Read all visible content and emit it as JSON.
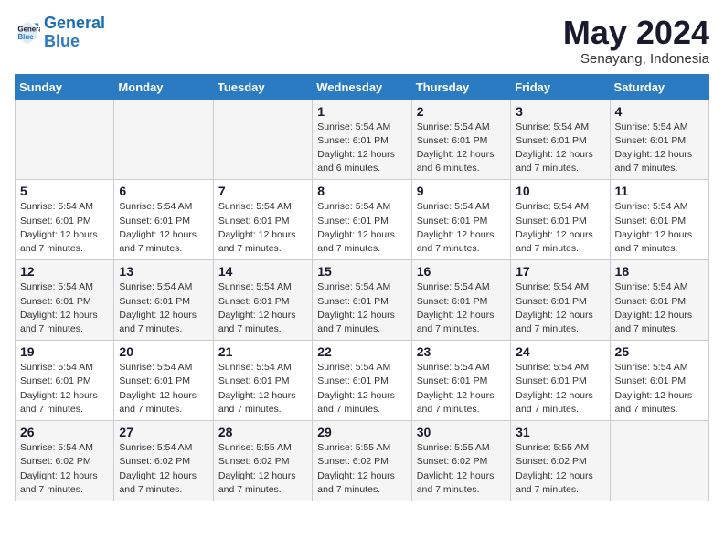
{
  "logo": {
    "line1": "General",
    "line2": "Blue"
  },
  "title": "May 2024",
  "subtitle": "Senayang, Indonesia",
  "days_of_week": [
    "Sunday",
    "Monday",
    "Tuesday",
    "Wednesday",
    "Thursday",
    "Friday",
    "Saturday"
  ],
  "weeks": [
    [
      {
        "day": "",
        "info": ""
      },
      {
        "day": "",
        "info": ""
      },
      {
        "day": "",
        "info": ""
      },
      {
        "day": "1",
        "info": "Sunrise: 5:54 AM\nSunset: 6:01 PM\nDaylight: 12 hours\nand 6 minutes."
      },
      {
        "day": "2",
        "info": "Sunrise: 5:54 AM\nSunset: 6:01 PM\nDaylight: 12 hours\nand 6 minutes."
      },
      {
        "day": "3",
        "info": "Sunrise: 5:54 AM\nSunset: 6:01 PM\nDaylight: 12 hours\nand 7 minutes."
      },
      {
        "day": "4",
        "info": "Sunrise: 5:54 AM\nSunset: 6:01 PM\nDaylight: 12 hours\nand 7 minutes."
      }
    ],
    [
      {
        "day": "5",
        "info": "Sunrise: 5:54 AM\nSunset: 6:01 PM\nDaylight: 12 hours\nand 7 minutes."
      },
      {
        "day": "6",
        "info": "Sunrise: 5:54 AM\nSunset: 6:01 PM\nDaylight: 12 hours\nand 7 minutes."
      },
      {
        "day": "7",
        "info": "Sunrise: 5:54 AM\nSunset: 6:01 PM\nDaylight: 12 hours\nand 7 minutes."
      },
      {
        "day": "8",
        "info": "Sunrise: 5:54 AM\nSunset: 6:01 PM\nDaylight: 12 hours\nand 7 minutes."
      },
      {
        "day": "9",
        "info": "Sunrise: 5:54 AM\nSunset: 6:01 PM\nDaylight: 12 hours\nand 7 minutes."
      },
      {
        "day": "10",
        "info": "Sunrise: 5:54 AM\nSunset: 6:01 PM\nDaylight: 12 hours\nand 7 minutes."
      },
      {
        "day": "11",
        "info": "Sunrise: 5:54 AM\nSunset: 6:01 PM\nDaylight: 12 hours\nand 7 minutes."
      }
    ],
    [
      {
        "day": "12",
        "info": "Sunrise: 5:54 AM\nSunset: 6:01 PM\nDaylight: 12 hours\nand 7 minutes."
      },
      {
        "day": "13",
        "info": "Sunrise: 5:54 AM\nSunset: 6:01 PM\nDaylight: 12 hours\nand 7 minutes."
      },
      {
        "day": "14",
        "info": "Sunrise: 5:54 AM\nSunset: 6:01 PM\nDaylight: 12 hours\nand 7 minutes."
      },
      {
        "day": "15",
        "info": "Sunrise: 5:54 AM\nSunset: 6:01 PM\nDaylight: 12 hours\nand 7 minutes."
      },
      {
        "day": "16",
        "info": "Sunrise: 5:54 AM\nSunset: 6:01 PM\nDaylight: 12 hours\nand 7 minutes."
      },
      {
        "day": "17",
        "info": "Sunrise: 5:54 AM\nSunset: 6:01 PM\nDaylight: 12 hours\nand 7 minutes."
      },
      {
        "day": "18",
        "info": "Sunrise: 5:54 AM\nSunset: 6:01 PM\nDaylight: 12 hours\nand 7 minutes."
      }
    ],
    [
      {
        "day": "19",
        "info": "Sunrise: 5:54 AM\nSunset: 6:01 PM\nDaylight: 12 hours\nand 7 minutes."
      },
      {
        "day": "20",
        "info": "Sunrise: 5:54 AM\nSunset: 6:01 PM\nDaylight: 12 hours\nand 7 minutes."
      },
      {
        "day": "21",
        "info": "Sunrise: 5:54 AM\nSunset: 6:01 PM\nDaylight: 12 hours\nand 7 minutes."
      },
      {
        "day": "22",
        "info": "Sunrise: 5:54 AM\nSunset: 6:01 PM\nDaylight: 12 hours\nand 7 minutes."
      },
      {
        "day": "23",
        "info": "Sunrise: 5:54 AM\nSunset: 6:01 PM\nDaylight: 12 hours\nand 7 minutes."
      },
      {
        "day": "24",
        "info": "Sunrise: 5:54 AM\nSunset: 6:01 PM\nDaylight: 12 hours\nand 7 minutes."
      },
      {
        "day": "25",
        "info": "Sunrise: 5:54 AM\nSunset: 6:01 PM\nDaylight: 12 hours\nand 7 minutes."
      }
    ],
    [
      {
        "day": "26",
        "info": "Sunrise: 5:54 AM\nSunset: 6:02 PM\nDaylight: 12 hours\nand 7 minutes."
      },
      {
        "day": "27",
        "info": "Sunrise: 5:54 AM\nSunset: 6:02 PM\nDaylight: 12 hours\nand 7 minutes."
      },
      {
        "day": "28",
        "info": "Sunrise: 5:55 AM\nSunset: 6:02 PM\nDaylight: 12 hours\nand 7 minutes."
      },
      {
        "day": "29",
        "info": "Sunrise: 5:55 AM\nSunset: 6:02 PM\nDaylight: 12 hours\nand 7 minutes."
      },
      {
        "day": "30",
        "info": "Sunrise: 5:55 AM\nSunset: 6:02 PM\nDaylight: 12 hours\nand 7 minutes."
      },
      {
        "day": "31",
        "info": "Sunrise: 5:55 AM\nSunset: 6:02 PM\nDaylight: 12 hours\nand 7 minutes."
      },
      {
        "day": "",
        "info": ""
      }
    ]
  ]
}
